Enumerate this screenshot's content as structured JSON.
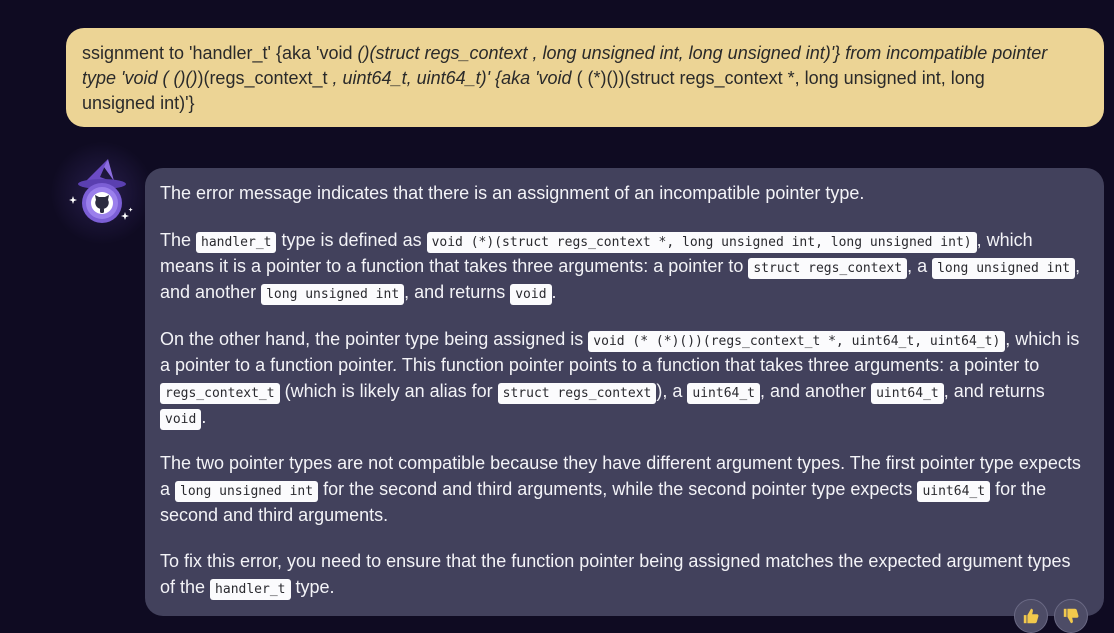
{
  "user_message": {
    "line1_a": "ssignment to 'handler_t' {aka 'void ",
    "line1_b": "()(struct regs_context , long unsigned int, long unsigned int)'} from incompatible pointer",
    "line2_a": "type 'void ( ()()",
    "line2_b": ")(regs_context_t ",
    "line2_c": ", uint64_t, uint64_t)' {aka 'void ",
    "line2_d": "( (*)())(struct regs_context *, long unsigned int, long",
    "line3": "unsigned int)'}"
  },
  "assistant_message": {
    "p1": "The error message indicates that there is an assignment of an incompatible pointer type.",
    "p2": {
      "t1": "The ",
      "c1": "handler_t",
      "t2": " type is defined as ",
      "c2": "void (*)(struct regs_context *, long unsigned int, long unsigned int)",
      "t3": ", which means it is a pointer to a function that takes three arguments: a pointer to ",
      "c3": "struct regs_context",
      "t4": ", a ",
      "c4": "long unsigned int",
      "t5": ", and another ",
      "c5": "long unsigned int",
      "t6": ", and returns ",
      "c6": "void",
      "t7": "."
    },
    "p3": {
      "t1": "On the other hand, the pointer type being assigned is ",
      "c1": "void (* (*)())(regs_context_t *, uint64_t, uint64_t)",
      "t2": ", which is a pointer to a function pointer. This function pointer points to a function that takes three arguments: a pointer to ",
      "c2": "regs_context_t",
      "t3": " (which is likely an alias for ",
      "c3": "struct regs_context",
      "t4": "), a ",
      "c4": "uint64_t",
      "t5": ", and another ",
      "c5": "uint64_t",
      "t6": ", and returns ",
      "c6": "void",
      "t7": "."
    },
    "p4": {
      "t1": "The two pointer types are not compatible because they have different argument types. The first pointer type expects a ",
      "c1": "long unsigned int",
      "t2": " for the second and third arguments, while the second pointer type expects ",
      "c2": "uint64_t",
      "t3": " for the second and third arguments."
    },
    "p5": {
      "t1": "To fix this error, you need to ensure that the function pointer being assigned matches the expected argument types of the ",
      "c1": "handler_t",
      "t2": " type."
    }
  },
  "icons": {
    "avatar": "github-wizard-avatar-icon",
    "thumbs_up": "thumbs-up-icon",
    "thumbs_down": "thumbs-down-icon"
  },
  "colors": {
    "background": "#0f0b22",
    "user_bubble": "#ecd495",
    "assistant_bubble": "#42415c",
    "accent": "#7c5fd6"
  }
}
